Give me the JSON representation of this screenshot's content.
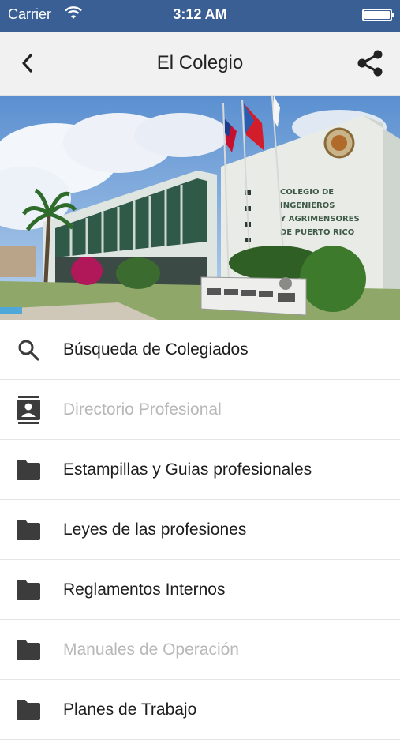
{
  "status_bar": {
    "carrier": "Carrier",
    "time": "3:12 AM",
    "battery_level": 1.0
  },
  "nav": {
    "title": "El Colegio",
    "back_icon": "chevron-left-icon",
    "share_icon": "share-icon"
  },
  "hero": {
    "building_sign": [
      "COLEGIO DE",
      "INGENIEROS",
      "Y AGRIMENSORES",
      "DE PUERTO RICO"
    ]
  },
  "menu": {
    "items": [
      {
        "label": "Búsqueda de Colegiados",
        "icon": "search-icon",
        "enabled": true
      },
      {
        "label": "Directorio Profesional",
        "icon": "contact-book-icon",
        "enabled": false
      },
      {
        "label": "Estampillas y Guias profesionales",
        "icon": "folder-icon",
        "enabled": true
      },
      {
        "label": "Leyes de las profesiones",
        "icon": "folder-icon",
        "enabled": true
      },
      {
        "label": "Reglamentos Internos",
        "icon": "folder-icon",
        "enabled": true
      },
      {
        "label": "Manuales de Operación",
        "icon": "folder-icon",
        "enabled": false
      },
      {
        "label": "Planes de Trabajo",
        "icon": "folder-icon",
        "enabled": true
      }
    ]
  },
  "colors": {
    "status_bar": "#3a5f95",
    "nav_bar": "#f1f1f1",
    "icon": "#3c3c3c",
    "text": "#1d1d1d",
    "disabled_text": "#b8b8b8"
  }
}
